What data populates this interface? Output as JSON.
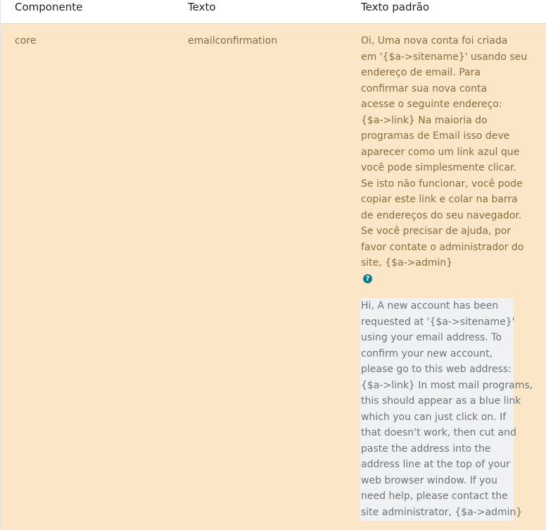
{
  "table": {
    "headers": [
      "Componente",
      "Texto",
      "Texto padrão"
    ],
    "row": {
      "component": "core",
      "text": "emailconfirmation",
      "default_text_lines": [
        "Oi, Uma nova conta foi criada",
        "em '{$a->sitename}' usando seu",
        "endereço de email. Para",
        "confirmar sua nova conta",
        "acesse o seguinte endereço:",
        "{$a->link} Na maioria do",
        "programas de Email isso deve",
        "aparecer como um link azul que",
        "você pode simplesmente clicar.",
        "Se isto não funcionar, você pode",
        "copiar este link e colar na barra",
        "de endereços do seu navegador.",
        "Se você precisar de ajuda, por",
        "favor contate o administrador do",
        "site, {$a->admin}"
      ],
      "help_icon": "question-circle-icon",
      "english_text_lines": [
        "Hi, A new account has been",
        "requested at '{$a->sitename}'",
        "using your email address. To",
        "confirm your new account,",
        "please go to this web address:",
        "{$a->link} In most mail programs,",
        "this should appear as a blue link",
        "which you can just click on. If",
        "that doesn't work, then cut and",
        "paste the address into the",
        "address line at the top of your",
        "web browser window. If you",
        "need help, please contact the",
        "site administrator, {$a->admin}"
      ]
    }
  },
  "colors": {
    "row_background": "#fce6c8",
    "row_text": "#8a6b3c",
    "help_icon": "#117a8b",
    "english_box_background": "#f0f1f3",
    "english_text": "#6a737b"
  }
}
